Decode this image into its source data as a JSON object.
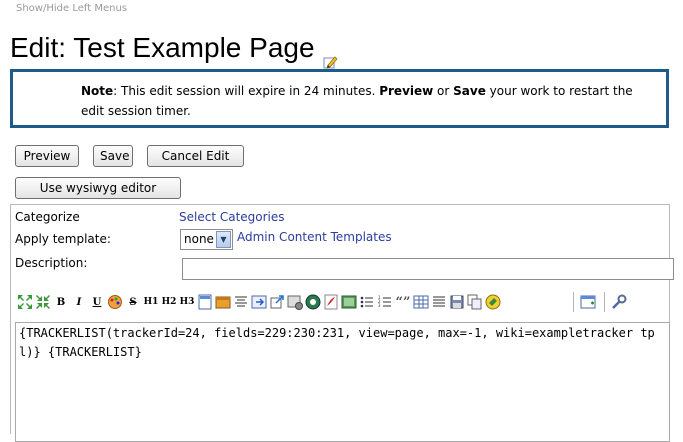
{
  "top_link": "Show/Hide Left Menus",
  "page_title": "Edit: Test Example Page",
  "notice": {
    "label": "Note",
    "text_1": ": This edit session will expire in 24 minutes. ",
    "preview_word": "Preview",
    "text_2": " or ",
    "save_word": "Save",
    "text_3": " your work to restart the edit session timer."
  },
  "buttons": {
    "preview": "Preview",
    "save": "Save",
    "cancel": "Cancel Edit",
    "wysiwyg": "Use wysiwyg editor"
  },
  "form": {
    "categorize_label": "Categorize",
    "select_categories_link": "Select Categories",
    "apply_template_label": "Apply template:",
    "template_selected": "none",
    "admin_templates_link": "Admin Content Templates",
    "description_label": "Description:",
    "description_value": ""
  },
  "toolbar": {
    "bold": "B",
    "italic": "I",
    "underline": "U",
    "strike": "S",
    "h1": "H1",
    "h2": "H2",
    "h3": "H3",
    "quote": "“”"
  },
  "editor_content": "{TRACKERLIST(trackerId=24, fields=229:230:231, view=page, max=-1, wiki=exampletracker tpl)} {TRACKERLIST}",
  "colors": {
    "notice_border": "#1e5a8a",
    "link": "#2a3e9c"
  }
}
